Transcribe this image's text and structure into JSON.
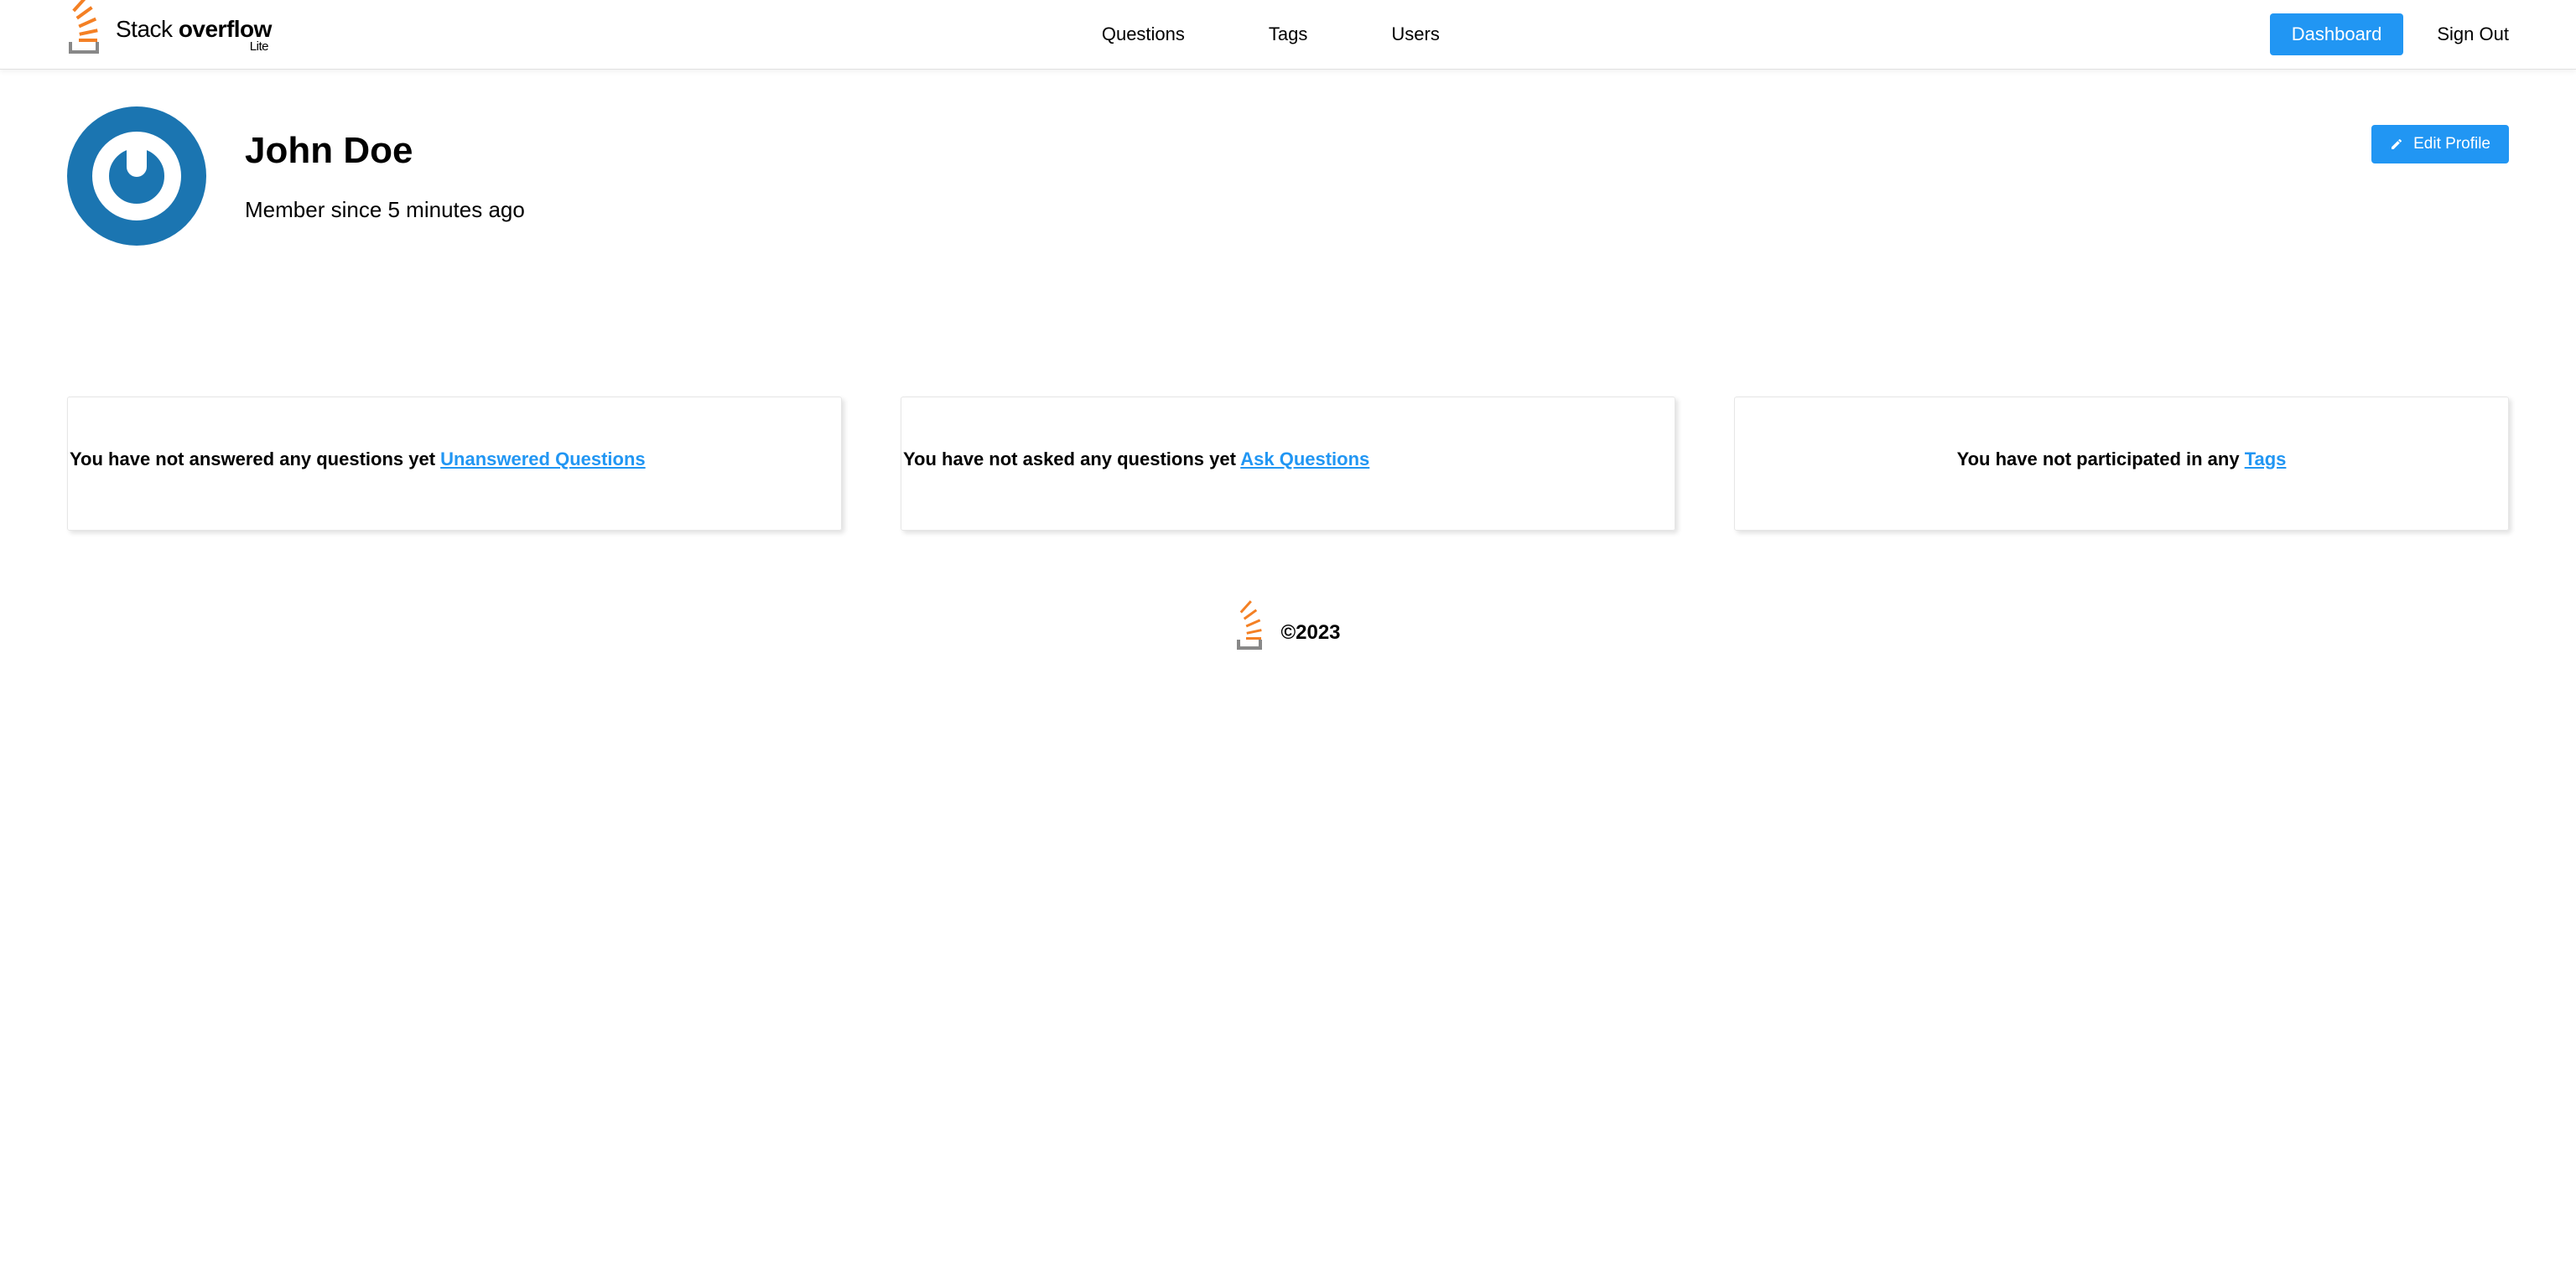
{
  "colors": {
    "accent": "#2196f3",
    "brand_orange": "#f48024",
    "avatar_blue": "#1b75b1"
  },
  "header": {
    "brand_main_regular": "Stack ",
    "brand_main_bold": "overflow",
    "brand_sub": "Lite",
    "nav": {
      "questions": "Questions",
      "tags": "Tags",
      "users": "Users"
    },
    "dashboard": "Dashboard",
    "signout": "Sign Out"
  },
  "profile": {
    "name": "John Doe",
    "member_since": "Member since 5 minutes ago",
    "edit_label": "Edit Profile"
  },
  "cards": {
    "answers_text": "You have not answered any questions yet ",
    "answers_link": "Unanswered Questions",
    "questions_text": "You have not asked any questions yet  ",
    "questions_link": "Ask Questions",
    "tags_text": "You have not participated in any ",
    "tags_link": "Tags"
  },
  "footer": {
    "copyright": "©2023"
  }
}
